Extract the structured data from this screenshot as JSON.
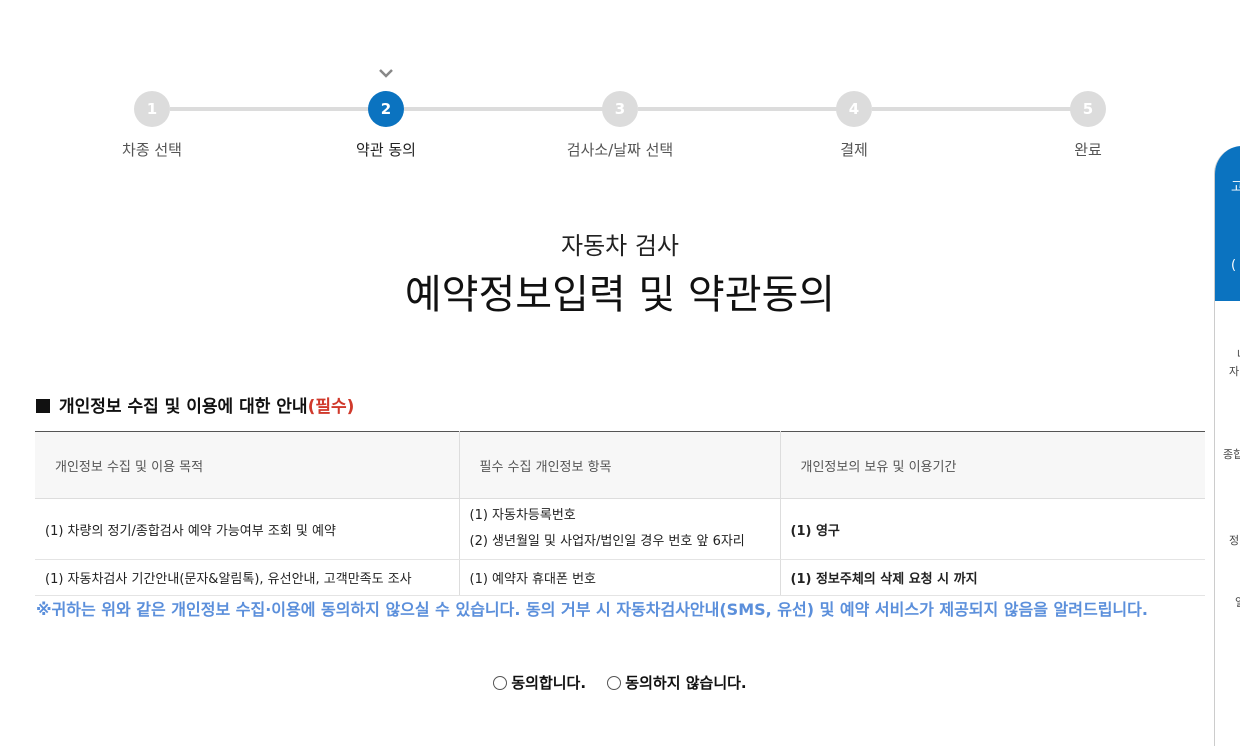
{
  "steps": [
    {
      "num": "1",
      "label": "차종 선택"
    },
    {
      "num": "2",
      "label": "약관 동의"
    },
    {
      "num": "3",
      "label": "검사소/날짜 선택"
    },
    {
      "num": "4",
      "label": "결제"
    },
    {
      "num": "5",
      "label": "완료"
    }
  ],
  "current_step": 2,
  "header": {
    "subtitle": "자동차 검사",
    "title": "예약정보입력 및 약관동의"
  },
  "section": {
    "title": "개인정보 수집 및 이용에 대한 안내",
    "required": "(필수)"
  },
  "table": {
    "headers": [
      "개인정보 수집 및 이용 목적",
      "필수 수집 개인정보 항목",
      "개인정보의 보유 및 이용기간"
    ],
    "rows": [
      {
        "purpose": "(1) 차량의 정기/종합검사 예약 가능여부 조회 및 예약",
        "items": [
          "(1) 자동차등록번호",
          "(2) 생년월일 및 사업자/법인일 경우 번호 앞 6자리"
        ],
        "period": "(1) 영구"
      },
      {
        "purpose": "(1) 자동차검사 기간안내(문자&알림톡), 유선안내, 고객만족도 조사",
        "items": [
          "(1) 예약자 휴대폰 번호"
        ],
        "period": "(1) 정보주체의 삭제 요청 시 까지"
      }
    ]
  },
  "notice": "※귀하는 위와 같은 개인정보 수집·이용에 동의하지 않으실 수 있습니다. 동의 거부 시 자동차검사안내(SMS, 유선) 및 예약 서비스가 제공되지 않음을 알려드립니다.",
  "consent": {
    "agree": "동의합니다.",
    "disagree": "동의하지 않습니다."
  },
  "side_panel": {
    "top_texts": [
      "고",
      "(",
      ""
    ],
    "texts": [
      "나",
      "자",
      "종합",
      "정",
      "일"
    ]
  },
  "colors": {
    "accent": "#0b73c0",
    "inactive_step": "#dcdcdc",
    "required": "#d0392b",
    "notice": "#5b8fdb",
    "period": "#4a7fd0"
  }
}
